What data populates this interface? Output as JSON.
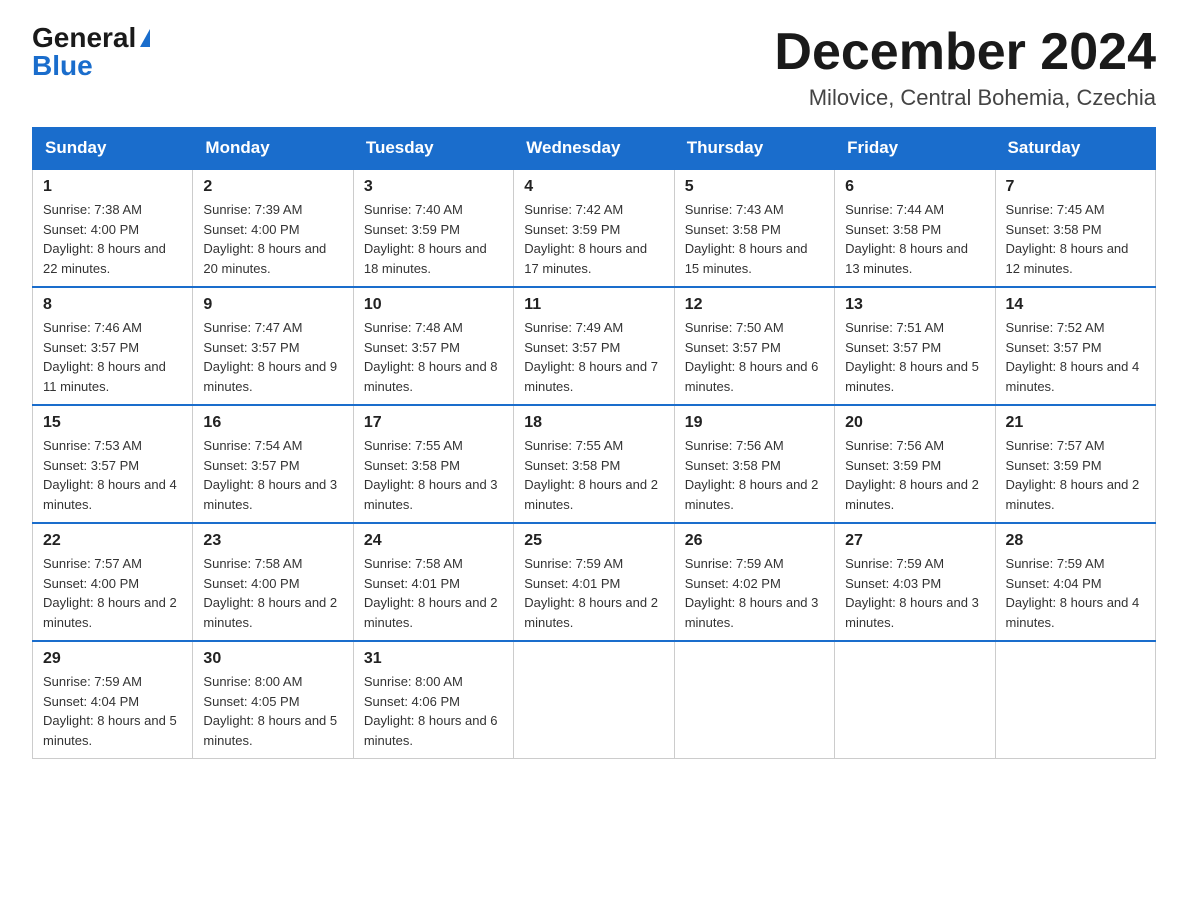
{
  "logo": {
    "general": "General",
    "blue": "Blue"
  },
  "title": "December 2024",
  "location": "Milovice, Central Bohemia, Czechia",
  "days_of_week": [
    "Sunday",
    "Monday",
    "Tuesday",
    "Wednesday",
    "Thursday",
    "Friday",
    "Saturday"
  ],
  "weeks": [
    [
      {
        "day": "1",
        "sunrise": "7:38 AM",
        "sunset": "4:00 PM",
        "daylight": "8 hours and 22 minutes."
      },
      {
        "day": "2",
        "sunrise": "7:39 AM",
        "sunset": "4:00 PM",
        "daylight": "8 hours and 20 minutes."
      },
      {
        "day": "3",
        "sunrise": "7:40 AM",
        "sunset": "3:59 PM",
        "daylight": "8 hours and 18 minutes."
      },
      {
        "day": "4",
        "sunrise": "7:42 AM",
        "sunset": "3:59 PM",
        "daylight": "8 hours and 17 minutes."
      },
      {
        "day": "5",
        "sunrise": "7:43 AM",
        "sunset": "3:58 PM",
        "daylight": "8 hours and 15 minutes."
      },
      {
        "day": "6",
        "sunrise": "7:44 AM",
        "sunset": "3:58 PM",
        "daylight": "8 hours and 13 minutes."
      },
      {
        "day": "7",
        "sunrise": "7:45 AM",
        "sunset": "3:58 PM",
        "daylight": "8 hours and 12 minutes."
      }
    ],
    [
      {
        "day": "8",
        "sunrise": "7:46 AM",
        "sunset": "3:57 PM",
        "daylight": "8 hours and 11 minutes."
      },
      {
        "day": "9",
        "sunrise": "7:47 AM",
        "sunset": "3:57 PM",
        "daylight": "8 hours and 9 minutes."
      },
      {
        "day": "10",
        "sunrise": "7:48 AM",
        "sunset": "3:57 PM",
        "daylight": "8 hours and 8 minutes."
      },
      {
        "day": "11",
        "sunrise": "7:49 AM",
        "sunset": "3:57 PM",
        "daylight": "8 hours and 7 minutes."
      },
      {
        "day": "12",
        "sunrise": "7:50 AM",
        "sunset": "3:57 PM",
        "daylight": "8 hours and 6 minutes."
      },
      {
        "day": "13",
        "sunrise": "7:51 AM",
        "sunset": "3:57 PM",
        "daylight": "8 hours and 5 minutes."
      },
      {
        "day": "14",
        "sunrise": "7:52 AM",
        "sunset": "3:57 PM",
        "daylight": "8 hours and 4 minutes."
      }
    ],
    [
      {
        "day": "15",
        "sunrise": "7:53 AM",
        "sunset": "3:57 PM",
        "daylight": "8 hours and 4 minutes."
      },
      {
        "day": "16",
        "sunrise": "7:54 AM",
        "sunset": "3:57 PM",
        "daylight": "8 hours and 3 minutes."
      },
      {
        "day": "17",
        "sunrise": "7:55 AM",
        "sunset": "3:58 PM",
        "daylight": "8 hours and 3 minutes."
      },
      {
        "day": "18",
        "sunrise": "7:55 AM",
        "sunset": "3:58 PM",
        "daylight": "8 hours and 2 minutes."
      },
      {
        "day": "19",
        "sunrise": "7:56 AM",
        "sunset": "3:58 PM",
        "daylight": "8 hours and 2 minutes."
      },
      {
        "day": "20",
        "sunrise": "7:56 AM",
        "sunset": "3:59 PM",
        "daylight": "8 hours and 2 minutes."
      },
      {
        "day": "21",
        "sunrise": "7:57 AM",
        "sunset": "3:59 PM",
        "daylight": "8 hours and 2 minutes."
      }
    ],
    [
      {
        "day": "22",
        "sunrise": "7:57 AM",
        "sunset": "4:00 PM",
        "daylight": "8 hours and 2 minutes."
      },
      {
        "day": "23",
        "sunrise": "7:58 AM",
        "sunset": "4:00 PM",
        "daylight": "8 hours and 2 minutes."
      },
      {
        "day": "24",
        "sunrise": "7:58 AM",
        "sunset": "4:01 PM",
        "daylight": "8 hours and 2 minutes."
      },
      {
        "day": "25",
        "sunrise": "7:59 AM",
        "sunset": "4:01 PM",
        "daylight": "8 hours and 2 minutes."
      },
      {
        "day": "26",
        "sunrise": "7:59 AM",
        "sunset": "4:02 PM",
        "daylight": "8 hours and 3 minutes."
      },
      {
        "day": "27",
        "sunrise": "7:59 AM",
        "sunset": "4:03 PM",
        "daylight": "8 hours and 3 minutes."
      },
      {
        "day": "28",
        "sunrise": "7:59 AM",
        "sunset": "4:04 PM",
        "daylight": "8 hours and 4 minutes."
      }
    ],
    [
      {
        "day": "29",
        "sunrise": "7:59 AM",
        "sunset": "4:04 PM",
        "daylight": "8 hours and 5 minutes."
      },
      {
        "day": "30",
        "sunrise": "8:00 AM",
        "sunset": "4:05 PM",
        "daylight": "8 hours and 5 minutes."
      },
      {
        "day": "31",
        "sunrise": "8:00 AM",
        "sunset": "4:06 PM",
        "daylight": "8 hours and 6 minutes."
      },
      null,
      null,
      null,
      null
    ]
  ]
}
